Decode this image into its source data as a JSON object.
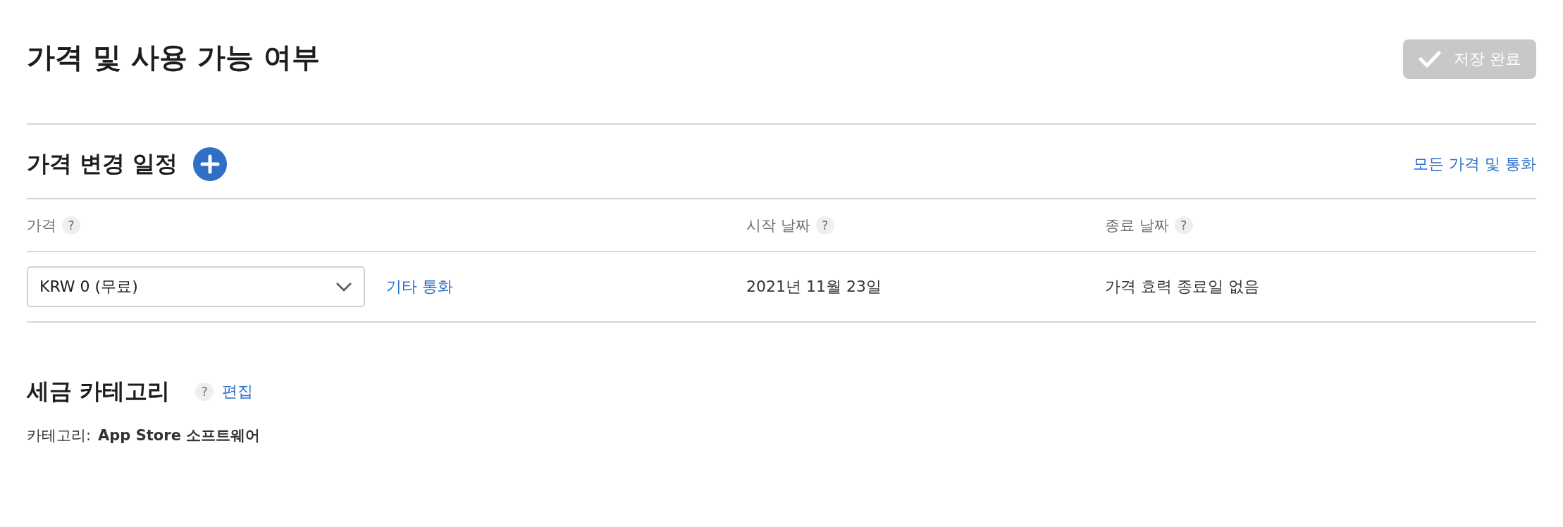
{
  "header": {
    "title": "가격 및 사용 가능 여부",
    "save_button": {
      "label": "저장 완료",
      "disabled": true
    }
  },
  "price_schedule": {
    "title": "가격 변경 일정",
    "all_prices_link": "모든 가격 및 통화",
    "columns": [
      {
        "label": "가격",
        "help": "?"
      },
      {
        "label": "시작 날짜",
        "help": "?"
      },
      {
        "label": "종료 날짜",
        "help": "?"
      }
    ],
    "rows": [
      {
        "price": "KRW 0 (무료)",
        "other_currency_link": "기타 통화",
        "start_date": "2021년 11월 23일",
        "end_date": "가격 효력 종료일 없음"
      }
    ]
  },
  "tax_category": {
    "title": "세금 카테고리",
    "help": "?",
    "edit_link": "편집",
    "label": "카테고리:",
    "value": "App Store 소프트웨어"
  }
}
